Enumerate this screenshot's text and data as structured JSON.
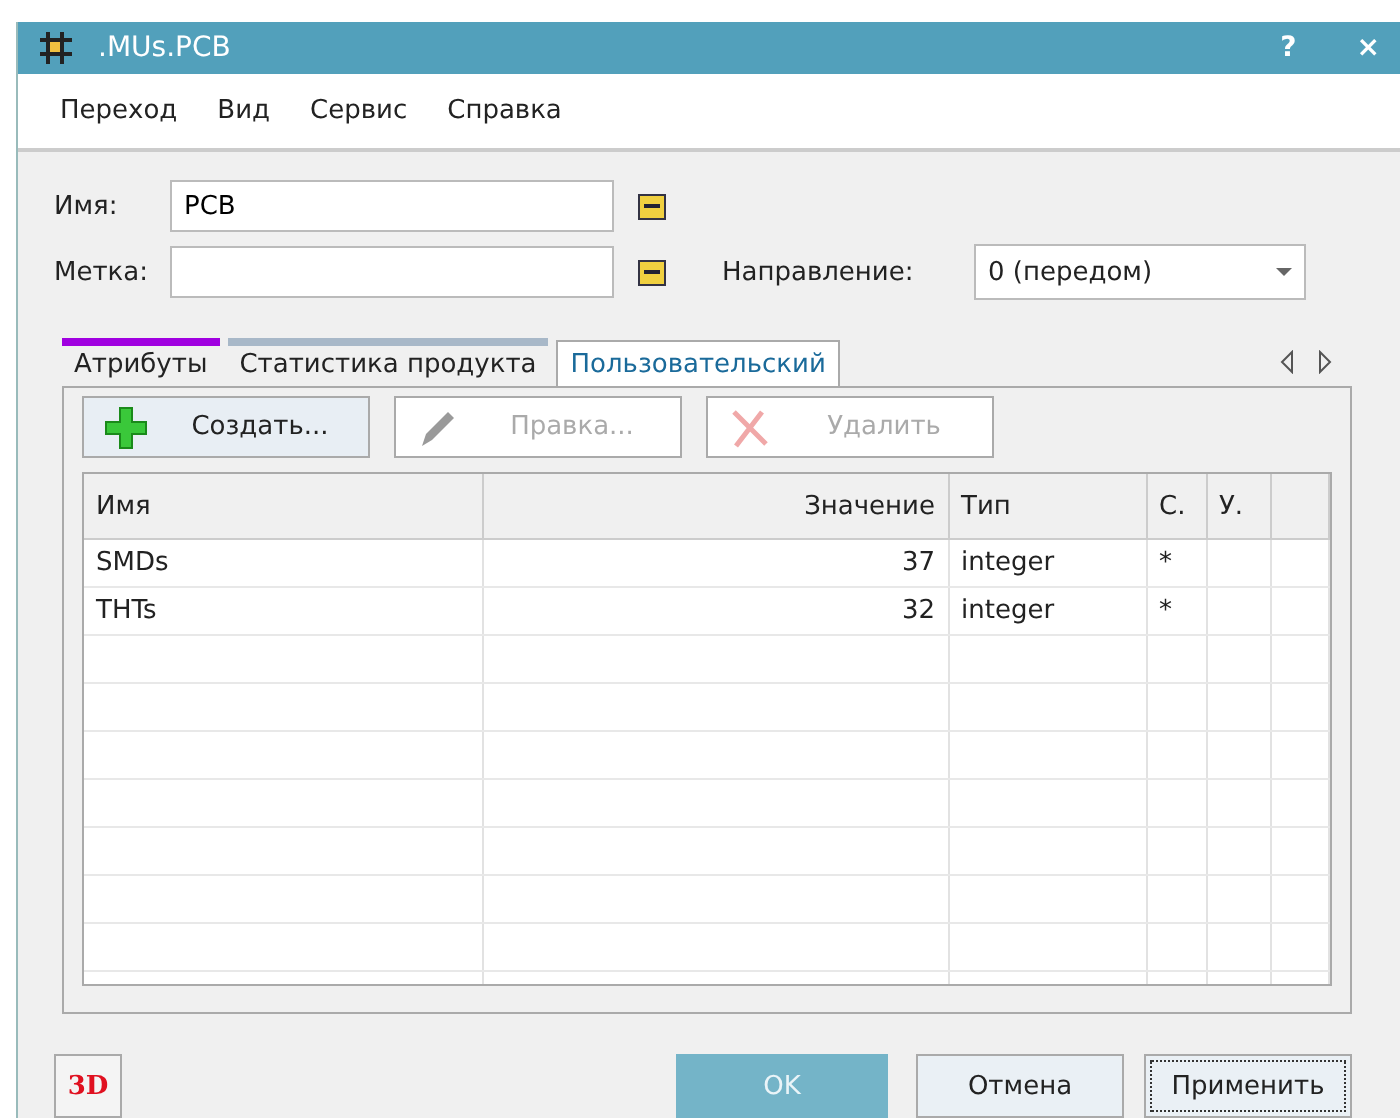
{
  "window": {
    "title": ".MUs.PCB",
    "help": "?",
    "close": "×"
  },
  "menu": [
    "Переход",
    "Вид",
    "Сервис",
    "Справка"
  ],
  "fields": {
    "name_label": "Имя:",
    "name_value": "PCB",
    "tag_label": "Метка:",
    "direction_label": "Направление:",
    "direction_value": "0 (передом)"
  },
  "tabs": [
    {
      "label": "Атрибуты",
      "selected": false,
      "color": "#a000e0"
    },
    {
      "label": "Статистика продукта",
      "selected": false,
      "color": "#a8b8c8"
    },
    {
      "label": "Пользовательский",
      "selected": true
    }
  ],
  "toolbar": [
    {
      "kind": "add",
      "label": "Создать...",
      "disabled": false
    },
    {
      "kind": "edit",
      "label": "Правка...",
      "disabled": true
    },
    {
      "kind": "delete",
      "label": "Удалить",
      "disabled": true
    }
  ],
  "table": {
    "columns": [
      "Имя",
      "Значение",
      "Тип",
      "С.",
      "У."
    ],
    "rows": [
      [
        "SMDs",
        "37",
        "integer",
        "*",
        ""
      ],
      [
        "THTs",
        "32",
        "integer",
        "*",
        ""
      ]
    ]
  },
  "buttons": {
    "three_d": "3D",
    "ok": "OK",
    "cancel": "Отмена",
    "apply": "Применить"
  }
}
